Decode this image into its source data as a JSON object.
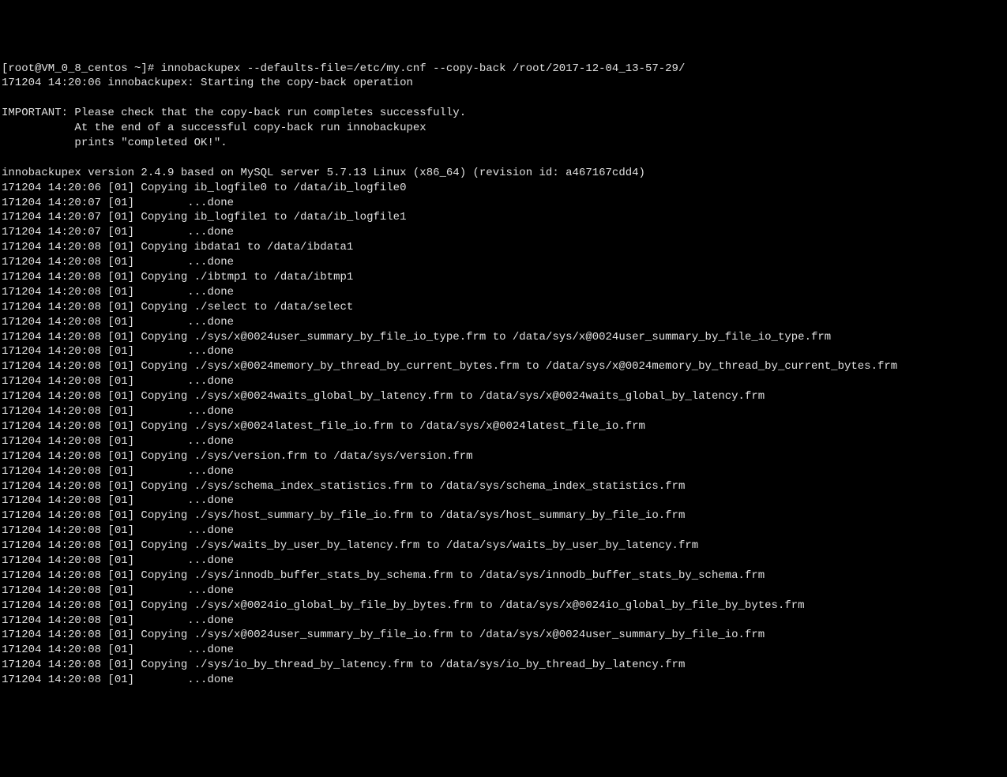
{
  "prompt": "[root@VM_0_8_centos ~]# ",
  "command": "innobackupex --defaults-file=/etc/my.cnf --copy-back /root/2017-12-04_13-57-29/",
  "start_line": "171204 14:20:06 innobackupex: Starting the copy-back operation",
  "important_header": "IMPORTANT: Please check that the copy-back run completes successfully.",
  "important_line2": "           At the end of a successful copy-back run innobackupex",
  "important_line3": "           prints \"completed OK!\".",
  "version_line": "innobackupex version 2.4.9 based on MySQL server 5.7.13 Linux (x86_64) (revision id: a467167cdd4)",
  "log_lines": [
    "171204 14:20:06 [01] Copying ib_logfile0 to /data/ib_logfile0",
    "171204 14:20:07 [01]        ...done",
    "171204 14:20:07 [01] Copying ib_logfile1 to /data/ib_logfile1",
    "171204 14:20:07 [01]        ...done",
    "171204 14:20:08 [01] Copying ibdata1 to /data/ibdata1",
    "171204 14:20:08 [01]        ...done",
    "171204 14:20:08 [01] Copying ./ibtmp1 to /data/ibtmp1",
    "171204 14:20:08 [01]        ...done",
    "171204 14:20:08 [01] Copying ./select to /data/select",
    "171204 14:20:08 [01]        ...done",
    "171204 14:20:08 [01] Copying ./sys/x@0024user_summary_by_file_io_type.frm to /data/sys/x@0024user_summary_by_file_io_type.frm",
    "171204 14:20:08 [01]        ...done",
    "171204 14:20:08 [01] Copying ./sys/x@0024memory_by_thread_by_current_bytes.frm to /data/sys/x@0024memory_by_thread_by_current_bytes.frm",
    "171204 14:20:08 [01]        ...done",
    "171204 14:20:08 [01] Copying ./sys/x@0024waits_global_by_latency.frm to /data/sys/x@0024waits_global_by_latency.frm",
    "171204 14:20:08 [01]        ...done",
    "171204 14:20:08 [01] Copying ./sys/x@0024latest_file_io.frm to /data/sys/x@0024latest_file_io.frm",
    "171204 14:20:08 [01]        ...done",
    "171204 14:20:08 [01] Copying ./sys/version.frm to /data/sys/version.frm",
    "171204 14:20:08 [01]        ...done",
    "171204 14:20:08 [01] Copying ./sys/schema_index_statistics.frm to /data/sys/schema_index_statistics.frm",
    "171204 14:20:08 [01]        ...done",
    "171204 14:20:08 [01] Copying ./sys/host_summary_by_file_io.frm to /data/sys/host_summary_by_file_io.frm",
    "171204 14:20:08 [01]        ...done",
    "171204 14:20:08 [01] Copying ./sys/waits_by_user_by_latency.frm to /data/sys/waits_by_user_by_latency.frm",
    "171204 14:20:08 [01]        ...done",
    "171204 14:20:08 [01] Copying ./sys/innodb_buffer_stats_by_schema.frm to /data/sys/innodb_buffer_stats_by_schema.frm",
    "171204 14:20:08 [01]        ...done",
    "171204 14:20:08 [01] Copying ./sys/x@0024io_global_by_file_by_bytes.frm to /data/sys/x@0024io_global_by_file_by_bytes.frm",
    "171204 14:20:08 [01]        ...done",
    "171204 14:20:08 [01] Copying ./sys/x@0024user_summary_by_file_io.frm to /data/sys/x@0024user_summary_by_file_io.frm",
    "171204 14:20:08 [01]        ...done",
    "171204 14:20:08 [01] Copying ./sys/io_by_thread_by_latency.frm to /data/sys/io_by_thread_by_latency.frm",
    "171204 14:20:08 [01]        ...done"
  ]
}
